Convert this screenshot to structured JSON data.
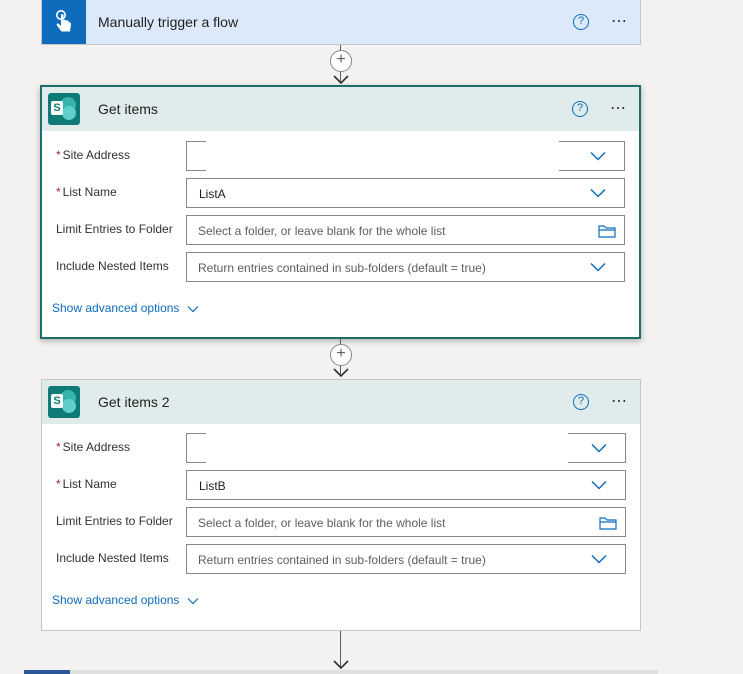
{
  "trigger": {
    "title": "Manually trigger a flow",
    "help_icon": "?",
    "more_icon": "⋯",
    "icon": "touch-hand-icon"
  },
  "connector_plus": "+",
  "steps": [
    {
      "title": "Get items",
      "app_icon": "sharepoint-icon",
      "app_letter": "S",
      "help_icon": "?",
      "more_icon": "⋯",
      "fields": {
        "site_address": {
          "label": "Site Address",
          "required": "*",
          "value": ""
        },
        "list_name": {
          "label": "List Name",
          "required": "*",
          "value": "ListA"
        },
        "limit_folder": {
          "label": "Limit Entries to Folder",
          "placeholder": "Select a folder, or leave blank for the whole list"
        },
        "nested_items": {
          "label": "Include Nested Items",
          "placeholder": "Return entries contained in sub-folders (default = true)"
        }
      },
      "advanced_link": "Show advanced options"
    },
    {
      "title": "Get items 2",
      "app_icon": "sharepoint-icon",
      "app_letter": "S",
      "help_icon": "?",
      "more_icon": "⋯",
      "fields": {
        "site_address": {
          "label": "Site Address",
          "required": "*",
          "value": ""
        },
        "list_name": {
          "label": "List Name",
          "required": "*",
          "value": "ListB"
        },
        "limit_folder": {
          "label": "Limit Entries to Folder",
          "placeholder": "Select a folder, or leave blank for the whole list"
        },
        "nested_items": {
          "label": "Include Nested Items",
          "placeholder": "Return entries contained in sub-folders (default = true)"
        }
      },
      "advanced_link": "Show advanced options"
    }
  ],
  "colors": {
    "accent": "#0f6cbd",
    "sharepoint": "#0f7b77",
    "selected_border": "#1d6e6a",
    "required": "#a4262c"
  }
}
